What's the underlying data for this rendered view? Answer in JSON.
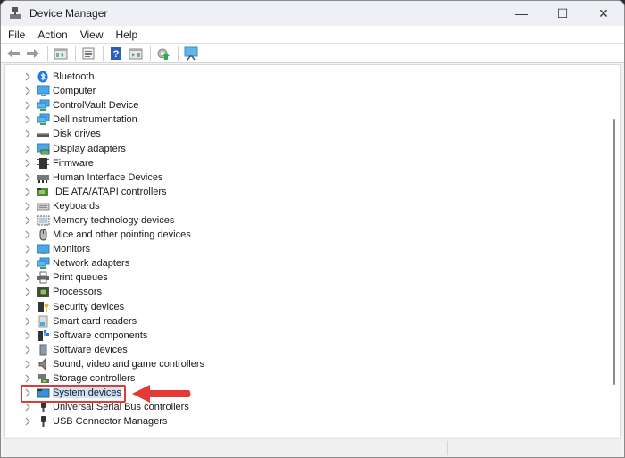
{
  "window": {
    "title": "Device Manager",
    "controls": {
      "minimize": "minimize",
      "maximize": "maximize",
      "close": "close"
    }
  },
  "menu": [
    "File",
    "Action",
    "View",
    "Help"
  ],
  "toolbar": {
    "buttons": [
      {
        "name": "back",
        "icon": "arrow-left-icon"
      },
      {
        "name": "forward",
        "icon": "arrow-right-icon"
      },
      {
        "name": "show-hide-console-tree",
        "icon": "console-tree-icon"
      },
      {
        "name": "properties",
        "icon": "properties-icon"
      },
      {
        "name": "help",
        "icon": "help-icon"
      },
      {
        "name": "show-action-pane",
        "icon": "action-pane-icon"
      },
      {
        "name": "update-driver",
        "icon": "update-driver-icon"
      },
      {
        "name": "scan-hardware",
        "icon": "scan-hardware-icon"
      }
    ]
  },
  "tree": {
    "items": [
      {
        "label": "Bluetooth",
        "icon": "bluetooth-icon"
      },
      {
        "label": "Computer",
        "icon": "computer-icon"
      },
      {
        "label": "ControlVault Device",
        "icon": "network-device-icon"
      },
      {
        "label": "DellInstrumentation",
        "icon": "network-device-icon"
      },
      {
        "label": "Disk drives",
        "icon": "disk-drive-icon"
      },
      {
        "label": "Display adapters",
        "icon": "display-adapter-icon"
      },
      {
        "label": "Firmware",
        "icon": "firmware-icon"
      },
      {
        "label": "Human Interface Devices",
        "icon": "hid-icon"
      },
      {
        "label": "IDE ATA/ATAPI controllers",
        "icon": "ide-controller-icon"
      },
      {
        "label": "Keyboards",
        "icon": "keyboard-icon"
      },
      {
        "label": "Memory technology devices",
        "icon": "memory-icon"
      },
      {
        "label": "Mice and other pointing devices",
        "icon": "mouse-icon"
      },
      {
        "label": "Monitors",
        "icon": "monitor-icon"
      },
      {
        "label": "Network adapters",
        "icon": "network-adapter-icon"
      },
      {
        "label": "Print queues",
        "icon": "printer-icon"
      },
      {
        "label": "Processors",
        "icon": "processor-icon"
      },
      {
        "label": "Security devices",
        "icon": "security-icon"
      },
      {
        "label": "Smart card readers",
        "icon": "smart-card-icon"
      },
      {
        "label": "Software components",
        "icon": "software-component-icon"
      },
      {
        "label": "Software devices",
        "icon": "software-device-icon"
      },
      {
        "label": "Sound, video and game controllers",
        "icon": "speaker-icon"
      },
      {
        "label": "Storage controllers",
        "icon": "storage-controller-icon"
      },
      {
        "label": "System devices",
        "icon": "system-device-icon",
        "highlighted": true
      },
      {
        "label": "Universal Serial Bus controllers",
        "icon": "usb-icon"
      },
      {
        "label": "USB Connector Managers",
        "icon": "usb-icon"
      }
    ]
  },
  "annotation": {
    "target": "System devices",
    "color": "#e53935"
  },
  "colors": {
    "highlight": "#cce4f7",
    "titlebar": "#eef0f6"
  }
}
